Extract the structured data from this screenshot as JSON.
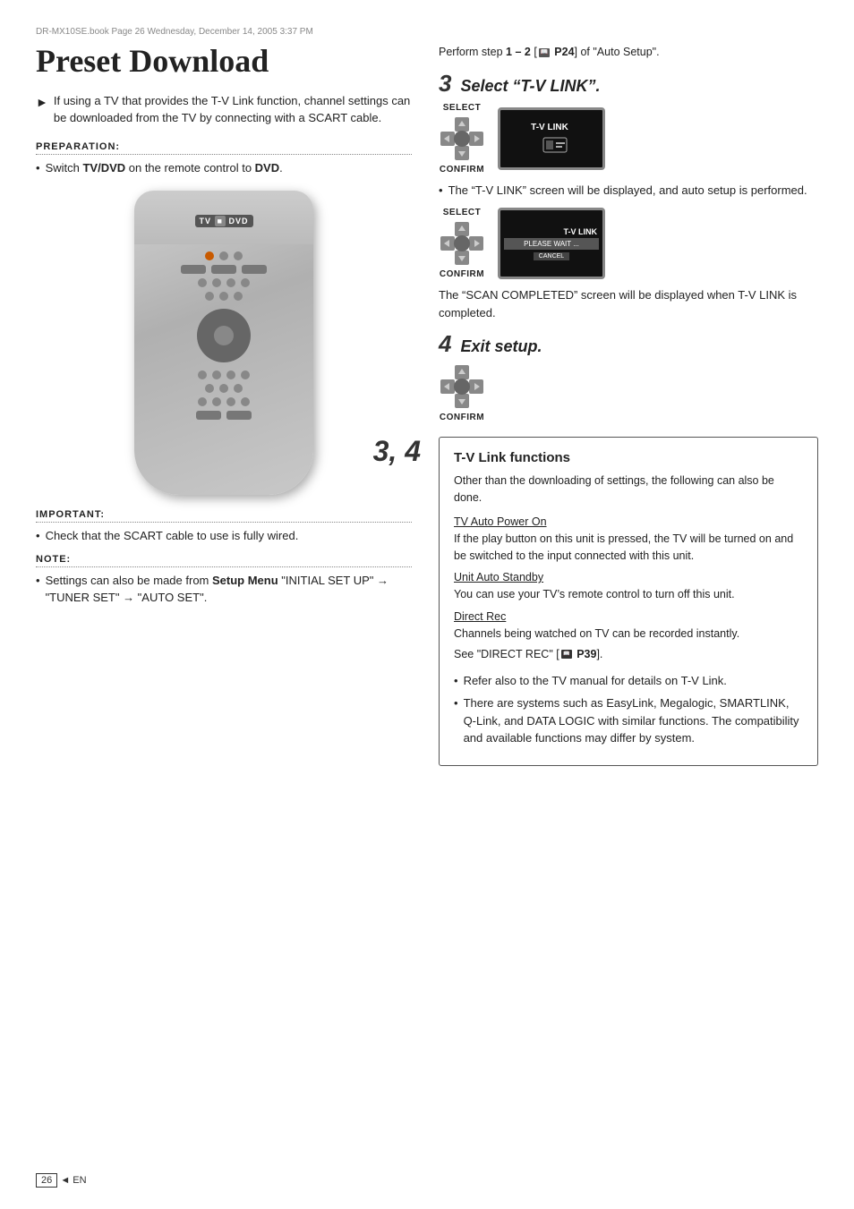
{
  "page": {
    "file_info": "DR-MX10SE.book  Page 26  Wednesday, December 14, 2005  3:37 PM",
    "page_number": "26",
    "page_label": "EN"
  },
  "left_column": {
    "title": "Preset Download",
    "intro_arrow": "►",
    "intro_text": "If using a TV that provides the T-V Link function, channel settings can be downloaded from the TV by connecting with a SCART cable.",
    "preparation_header": "PREPARATION:",
    "preparation_bullet": "Switch",
    "preparation_bold": "TV/DVD",
    "preparation_mid": "on the remote control to",
    "preparation_bold2": "DVD",
    "preparation_end": ".",
    "tv_dvd_label": "TV",
    "dvd_label": "DVD",
    "step_label": "3, 4",
    "important_header": "IMPORTANT:",
    "important_bullet": "Check that the SCART cable to use is fully wired.",
    "note_header": "NOTE:",
    "note_bullet": "Settings can also be made from",
    "note_bold": "Setup Menu",
    "note_end": "“INITIAL SET UP” → “TUNER SET” → “AUTO SET”."
  },
  "right_column": {
    "perform_step_text": "Perform step",
    "perform_step_nums": "1 – 2",
    "perform_step_ref": "[ P24]",
    "perform_step_end": "of “Auto Setup”.",
    "step3_num": "3",
    "step3_desc": "Select “T-V LINK”.",
    "select_label": "SELECT",
    "confirm_label": "CONFIRM",
    "tv_screen1_line1": "T-V LINK",
    "bullet1": "The “T-V LINK” screen will be displayed, and auto setup is performed.",
    "tv_screen2_line1": "T-V LINK",
    "tv_screen2_line2": "PLEASE WAIT ...",
    "tv_screen2_line3": "CANCEL",
    "scan_text": "The “SCAN COMPLETED” screen will be displayed when T-V LINK is completed.",
    "step4_num": "4",
    "step4_desc": "Exit setup.",
    "confirm_label2": "CONFIRM",
    "tvlink_box": {
      "title": "T-V Link functions",
      "intro": "Other than the downloading of settings, the following can also be done.",
      "section1_title": "TV Auto Power On",
      "section1_body": "If the play button on this unit is pressed, the TV will be turned on and be switched to the input connected with this unit.",
      "section2_title": "Unit Auto Standby",
      "section2_body": "You can use your TV’s remote control to turn off this unit.",
      "section3_title": "Direct Rec",
      "section3_body": "Channels being watched on TV can be recorded instantly.",
      "section3_see": "See “DIRECT REC” [ P39].",
      "bullet1": "Refer also to the TV manual for details on T-V Link.",
      "bullet2": "There are systems such as EasyLink, Megalogic, SMARTLINK, Q-Link, and DATA LOGIC with similar functions. The compatibility and available functions may differ by system."
    }
  }
}
